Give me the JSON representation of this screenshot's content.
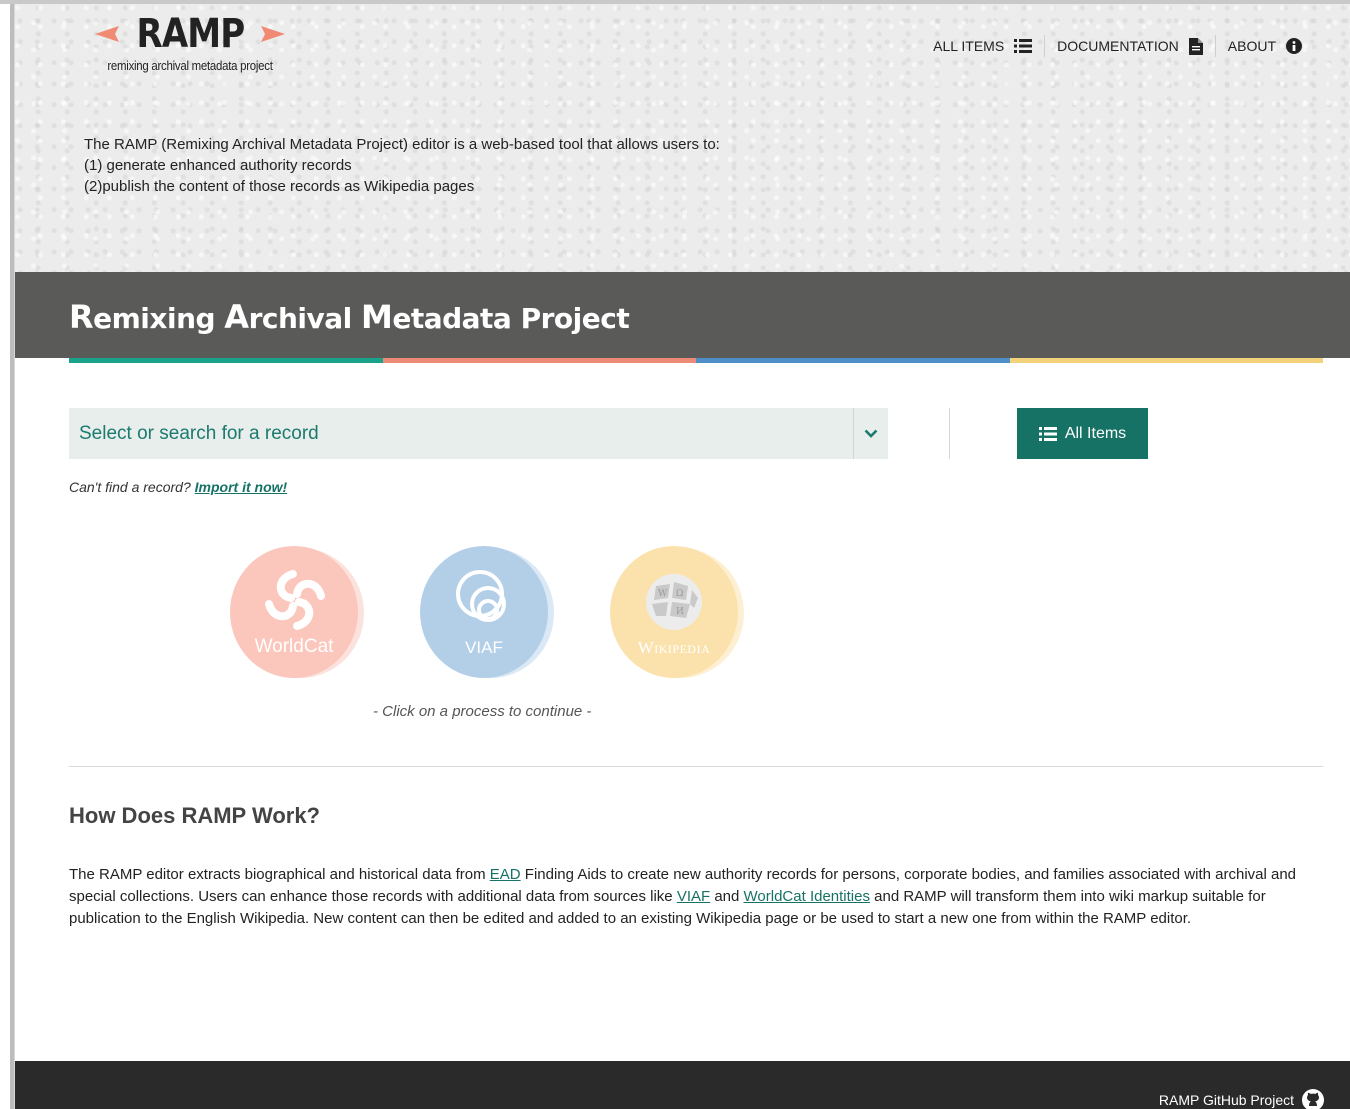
{
  "logo": {
    "name": "RAMP",
    "tagline": "remixing archival metadata project"
  },
  "nav": {
    "items": [
      {
        "label": "ALL ITEMS",
        "icon": "list-icon"
      },
      {
        "label": "DOCUMENTATION",
        "icon": "document-icon"
      },
      {
        "label": "ABOUT",
        "icon": "info-icon"
      }
    ]
  },
  "intro": {
    "lines": [
      "The RAMP (Remixing Archival Metadata Project) editor is a web-based tool that allows users to:",
      "(1) generate enhanced authority records",
      "(2)publish the content of those records as Wikipedia pages"
    ]
  },
  "banner": {
    "title_parts": [
      "R",
      "emixing ",
      "A",
      "rchival ",
      "M",
      "etadata Project"
    ]
  },
  "colors": {
    "teal": "#1aa28b",
    "salmon": "#ee8b77",
    "blue": "#4d8fc6",
    "yellow": "#f2d37c",
    "button": "#167265"
  },
  "search": {
    "placeholder": "Select or search for a record"
  },
  "all_items_button": {
    "label": "All Items"
  },
  "import": {
    "prompt": "Can't find a record?",
    "link": "Import it now!"
  },
  "processes": [
    {
      "label": "WorldCat",
      "icon": "worldcat-icon"
    },
    {
      "label": "VIAF",
      "icon": "viaf-icon"
    },
    {
      "label": "Wikipedia",
      "icon": "wikipedia-globe-icon"
    }
  ],
  "process_hint": "- Click on a process to continue -",
  "how": {
    "heading": "How Does RAMP Work?",
    "text_1": "The RAMP editor extracts biographical and historical data from ",
    "link_ead": "EAD",
    "text_2": " Finding Aids to create new authority records for persons, corporate bodies, and families associated with archival and special collections. Users can enhance those records with additional data from sources like ",
    "link_viaf": "VIAF",
    "text_3": " and ",
    "link_worldcat": "WorldCat Identities",
    "text_4": " and RAMP will transform them into wiki markup suitable for publication to the English Wikipedia. New content can then be edited and added to an existing Wikipedia page or be used to start a new one from within the RAMP editor."
  },
  "footer": {
    "github_label": "RAMP GitHub Project"
  }
}
